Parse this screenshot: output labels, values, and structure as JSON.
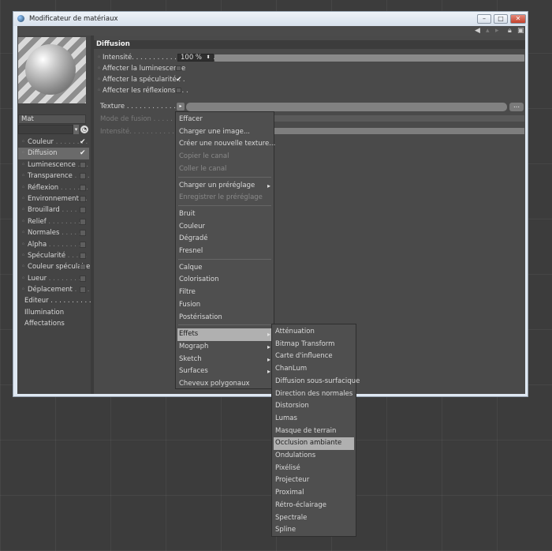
{
  "window": {
    "title": "Modificateur de matériaux",
    "controls": {
      "minimize": "–",
      "maximize": "□",
      "close": "✕"
    }
  },
  "toolbar": {
    "back_icon": "arrow-left-icon",
    "lock_icon": "lock-icon"
  },
  "material": {
    "name": "Mat"
  },
  "channels": [
    {
      "label": "Couleur",
      "dots": " . . . . . . . . ",
      "checked": true
    },
    {
      "label": "Diffusion",
      "dots": "",
      "checked": true,
      "selected": true
    },
    {
      "label": "Luminescence",
      "dots": " . . . .",
      "checked": false
    },
    {
      "label": "Transparence",
      "dots": " . . . .",
      "checked": false
    },
    {
      "label": "Réflexion",
      "dots": " . . . . . . .",
      "checked": false
    },
    {
      "label": "Environnement",
      "dots": " . .",
      "checked": false
    },
    {
      "label": "Brouillard",
      "dots": " . . . . . .",
      "checked": false
    },
    {
      "label": "Relief",
      "dots": " . . . . . . . . .",
      "checked": false
    },
    {
      "label": "Normales",
      "dots": " . . . . . .",
      "checked": false
    },
    {
      "label": "Alpha",
      "dots": " . . . . . . . . .",
      "checked": false
    },
    {
      "label": "Spécularité",
      "dots": " . . . . .",
      "checked": false
    },
    {
      "label": "Couleur spéculaire",
      "dots": "",
      "checked": false
    },
    {
      "label": "Lueur",
      "dots": " . . . . . . . . .",
      "checked": false
    },
    {
      "label": "Déplacement",
      "dots": " . . . .",
      "checked": false
    }
  ],
  "extras": [
    "Editeur . . . . . . . . . .",
    "Illumination",
    "Affectations"
  ],
  "diffusion": {
    "section": "Diffusion",
    "intensity_label": "Intensité. . . . . . . . . . . . . . . . . . . . .",
    "intensity_value": "100 %",
    "intensity_fraction": 1.0,
    "affect_lum": "Affecter la luminescence",
    "affect_spec": "Affecter la spécularité . .",
    "affect_spec_checked": true,
    "affect_refl": "Affecter les réflexions . . .",
    "texture_label": "Texture . . . . . . . . . . . . . . . . . . . . .",
    "texture_more": "...",
    "blend_label": "Mode de fusion . . . . . . . . . . . . . . .",
    "mix_label": "Intensité. . . . . . . . . . . . . . . . . . . . ."
  },
  "texture_menu": {
    "group1": [
      {
        "label": "Effacer",
        "enabled": true
      },
      {
        "label": "Charger une image...",
        "enabled": true
      },
      {
        "label": "Créer une nouvelle texture...",
        "enabled": true
      },
      {
        "label": "Copier le canal",
        "enabled": false
      },
      {
        "label": "Coller le canal",
        "enabled": false
      }
    ],
    "group2": [
      {
        "label": "Charger un préréglage",
        "enabled": true,
        "submenu": true
      },
      {
        "label": "Enregistrer le préréglage",
        "enabled": false
      }
    ],
    "group3": [
      "Bruit",
      "Couleur",
      "Dégradé",
      "Fresnel"
    ],
    "group4": [
      "Calque",
      "Colorisation",
      "Filtre",
      "Fusion",
      "Postérisation"
    ],
    "group5": [
      {
        "label": "Effets",
        "submenu": true,
        "highlighted": true
      },
      {
        "label": "Mograph",
        "submenu": true
      },
      {
        "label": "Sketch",
        "submenu": true
      },
      {
        "label": "Surfaces",
        "submenu": true
      },
      {
        "label": "Cheveux polygonaux",
        "submenu": false
      }
    ]
  },
  "effets_menu": {
    "items": [
      "Atténuation",
      "Bitmap Transform",
      "Carte d'influence",
      "ChanLum",
      "Diffusion sous-surfacique",
      "Direction des normales",
      "Distorsion",
      "Lumas",
      "Masque de terrain",
      "Occlusion ambiante",
      "Ondulations",
      "Pixélisé",
      "Projecteur",
      "Proximal",
      "Rétro-éclairage",
      "Spectrale",
      "Spline"
    ],
    "highlighted": "Occlusion ambiante"
  }
}
